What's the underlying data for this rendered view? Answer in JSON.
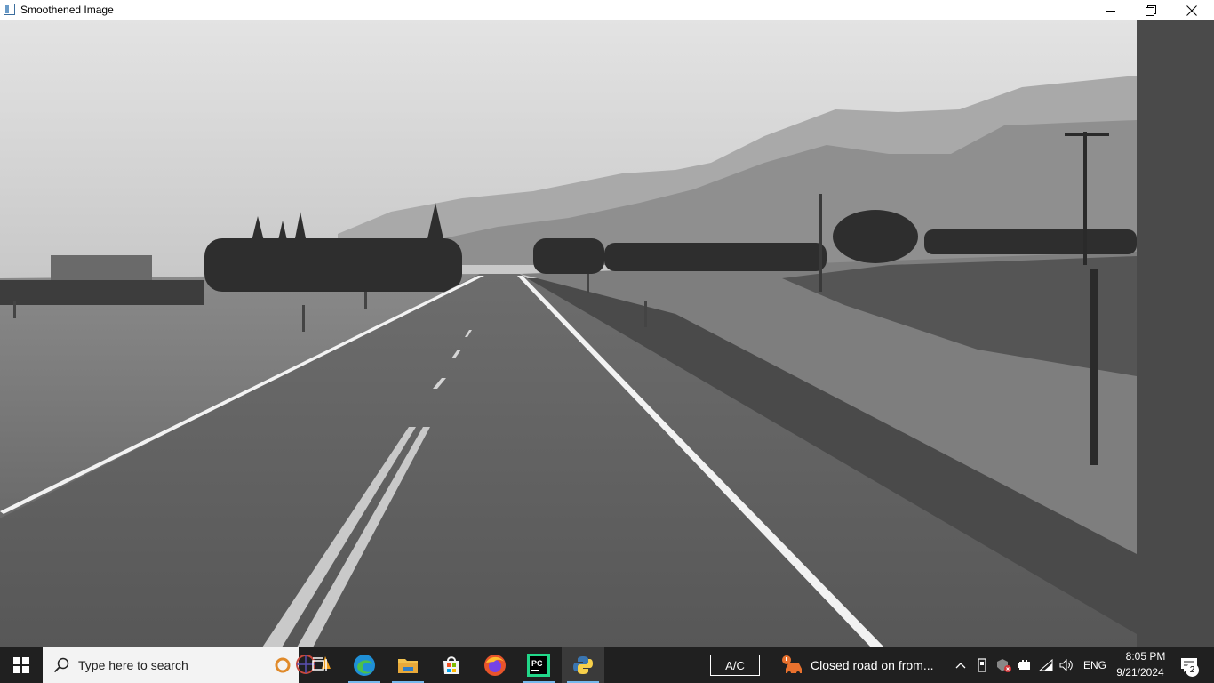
{
  "window": {
    "title": "Smoothened Image",
    "controls": {
      "minimize_icon": "minimize-icon",
      "maximize_icon": "restore-icon",
      "close_icon": "close-icon"
    }
  },
  "content": {
    "image_icon": "grayscale-road-photo"
  },
  "taskbar": {
    "start_icon": "windows-icon",
    "search": {
      "placeholder": "Type here to search"
    },
    "pinned": [
      {
        "name": "task-view",
        "icon": "task-view-icon"
      },
      {
        "name": "edge",
        "icon": "edge-icon"
      },
      {
        "name": "file-explorer",
        "icon": "folder-icon"
      },
      {
        "name": "microsoft-store",
        "icon": "store-icon"
      },
      {
        "name": "firefox",
        "icon": "firefox-icon"
      },
      {
        "name": "pycharm",
        "icon": "pycharm-icon",
        "pycharm_label": "PC"
      },
      {
        "name": "python",
        "icon": "python-icon"
      }
    ],
    "tray": {
      "ac_label": "A/C",
      "news_text": "Closed road on from...",
      "language": "ENG",
      "time": "8:05 PM",
      "date": "9/21/2024",
      "notification_count": "2"
    }
  }
}
